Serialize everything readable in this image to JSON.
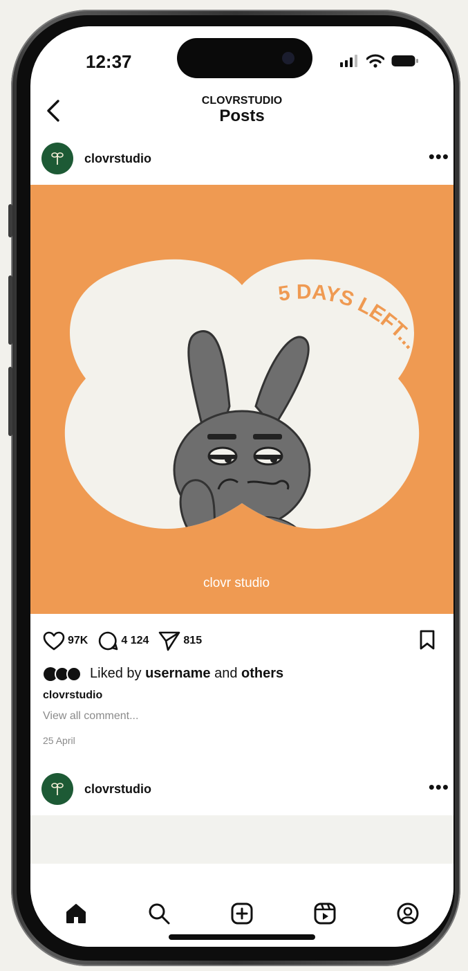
{
  "status_bar": {
    "time": "12:37"
  },
  "header": {
    "account": "CLOVRSTUDIO",
    "title": "Posts"
  },
  "post": {
    "username": "clovrstudio",
    "image": {
      "text": "5 DAYS LEFT...",
      "brand": "clovr studio"
    },
    "likes": "97K",
    "comments": "4 124",
    "shares": "815",
    "liked_by_prefix": "Liked by ",
    "liked_by_user": "username",
    "liked_by_and": " and ",
    "liked_by_others": "others",
    "caption_username": "clovrstudio",
    "view_comments": "View all comment...",
    "date": "25 April"
  },
  "next_post": {
    "username": "clovrstudio"
  },
  "tab_bar": {
    "items": [
      "home-icon",
      "search-icon",
      "create-icon",
      "reels-icon",
      "profile-icon"
    ]
  },
  "colors": {
    "brand_green": "#1d5a35",
    "post_orange": "#ef9a52",
    "cloud_cream": "#f3f2ec",
    "bunny_gray": "#6e6e6e"
  }
}
